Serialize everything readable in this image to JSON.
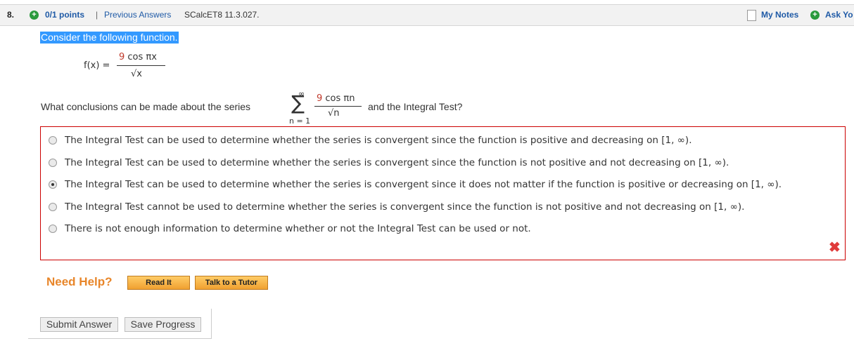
{
  "header": {
    "question_number": "8.",
    "points": "0/1 points",
    "separator": "|",
    "previous_answers": "Previous Answers",
    "problem_code": "SCalcET8 11.3.027.",
    "my_notes": "My Notes",
    "ask": "Ask Yo"
  },
  "intro": "Consider the following function.",
  "function": {
    "lhs": "f(x) =",
    "numerator_coef": "9",
    "numerator_rest": " cos πx",
    "denominator": "√x"
  },
  "question": {
    "prefix": "What conclusions can be made about the series",
    "sum_upper": "∞",
    "sum_symbol": "∑",
    "sum_lower": "n = 1",
    "term_coef": "9",
    "term_rest": " cos πn",
    "term_denominator": "√n",
    "suffix": "and the Integral Test?"
  },
  "choices": [
    {
      "text": "The Integral Test can be used to determine whether the series is convergent since the function is positive and decreasing on [1, ∞).",
      "selected": false
    },
    {
      "text": "The Integral Test can be used to determine whether the series is convergent since the function is not positive and not decreasing on [1, ∞).",
      "selected": false
    },
    {
      "text": "The Integral Test can be used to determine whether the series is convergent since it does not matter if the function is positive or decreasing on [1, ∞).",
      "selected": true
    },
    {
      "text": "The Integral Test cannot be used to determine whether the series is convergent since the function is not positive and not decreasing on [1, ∞).",
      "selected": false
    },
    {
      "text": "There is not enough information to determine whether or not the Integral Test can be used or not.",
      "selected": false
    }
  ],
  "result_mark": "✖",
  "help": {
    "label": "Need Help?",
    "read_it": "Read It",
    "talk_tutor": "Talk to a Tutor"
  },
  "actions": {
    "submit": "Submit Answer",
    "save": "Save Progress"
  },
  "colors": {
    "accent_link": "#1f5aa6",
    "error": "#cc0000",
    "help": "#e8862a",
    "selection": "#3399ff"
  }
}
